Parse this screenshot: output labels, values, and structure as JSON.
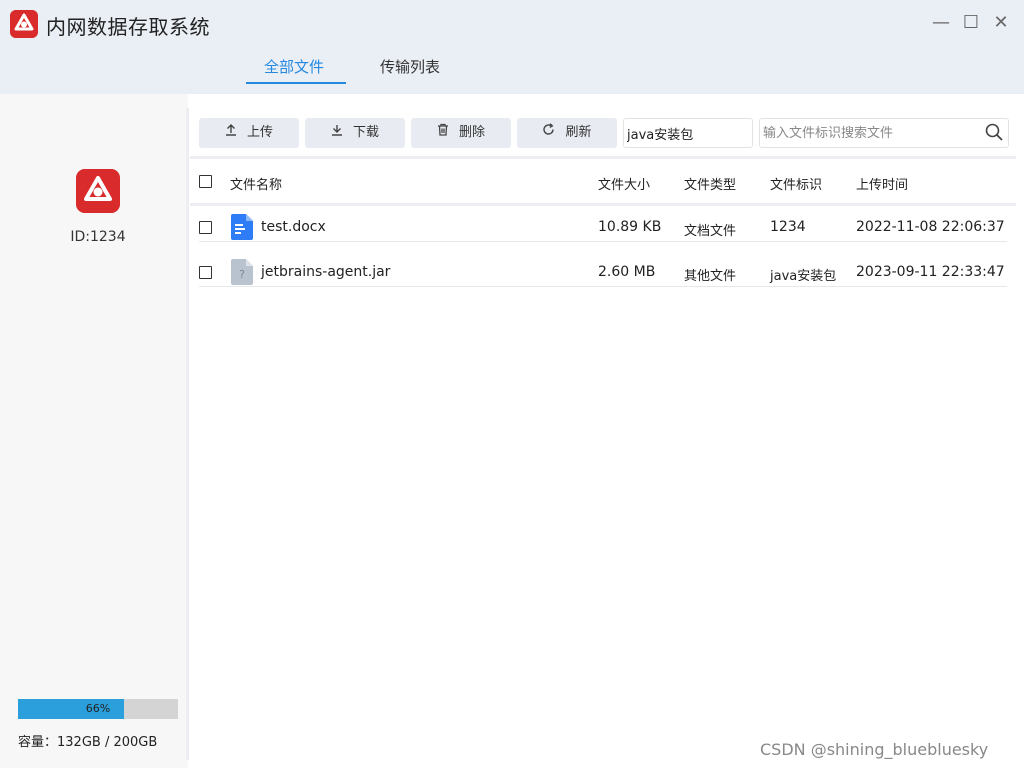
{
  "app": {
    "title": "内网数据存取系统",
    "brand_color": "#d92b2b",
    "accent_color": "#2589e0"
  },
  "window_controls": {
    "minimize": "—",
    "maximize": "☐",
    "close": "✕"
  },
  "tabs": [
    {
      "label": "全部文件",
      "active": true
    },
    {
      "label": "传输列表",
      "active": false
    }
  ],
  "sidebar": {
    "user_id": "ID:1234",
    "usage_label": "66%",
    "usage_fraction": 0.66,
    "capacity": "容量：132GB / 200GB"
  },
  "toolbar": {
    "upload_label": "上传",
    "download_label": "下载",
    "delete_label": "删除",
    "refresh_label": "刷新",
    "type_value": "java安装包",
    "search_placeholder": "输入文件标识搜索文件"
  },
  "table": {
    "headers": {
      "name": "文件名称",
      "size": "文件大小",
      "type": "文件类型",
      "tag": "文件标识",
      "time": "上传时间"
    },
    "rows": [
      {
        "name": "test.docx",
        "size": "10.89 KB",
        "type": "文档文件",
        "tag": "1234",
        "time": "2022-11-08 22:06:37",
        "icon": "word-document-icon"
      },
      {
        "name": "jetbrains-agent.jar",
        "size": "2.60 MB",
        "type": "其他文件",
        "tag": "java安装包",
        "time": "2023-09-11 22:33:47",
        "icon": "unknown-file-icon"
      }
    ]
  },
  "watermark": "CSDN @shining_bluebluesky"
}
